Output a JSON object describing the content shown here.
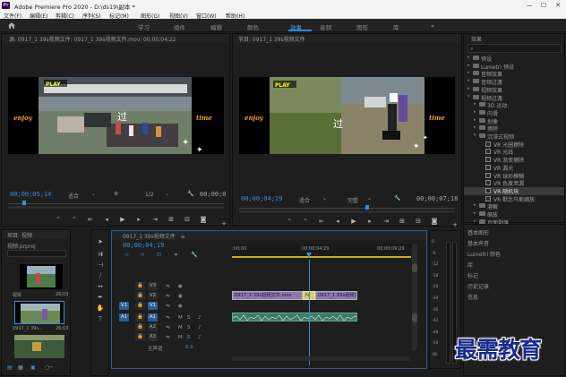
{
  "window": {
    "title": "Adobe Premiere Pro 2020 - D:\\ds19\\副本 *",
    "minimize": "—",
    "maximize": "☐",
    "close": "✕"
  },
  "menubar": [
    "文件(F)",
    "编辑(E)",
    "剪辑(C)",
    "序列(S)",
    "标记(M)",
    "图形(G)",
    "视图(V)",
    "窗口(W)",
    "帮助(H)"
  ],
  "workspace_tabs": [
    "学习",
    "组件",
    "编辑",
    "颜色",
    "效果",
    "音频",
    "图形",
    "库"
  ],
  "workspace_active": "效果",
  "source_monitor": {
    "header": "源: 0917_1 39s视频文件: 0917_1 39s视频文件.mov: 00;00;04;22",
    "timecode_in": "00;00;05;14",
    "fit": "适合",
    "ratio": "1/2",
    "timecode_out": "00;00;0",
    "overlay_text": "过",
    "play_label": "PLAY",
    "left_caption": "enjoy",
    "right_caption": "time"
  },
  "program_monitor": {
    "header": "节目: 0917_1 39s视频文件",
    "timecode_in": "00;00;04;19",
    "fit": "适合",
    "quality": "完整",
    "timecode_out": "00;00;07;18",
    "overlay_text": "过",
    "play_label": "PLAY",
    "left_caption": "enjoy",
    "right_caption": "time"
  },
  "effects_panel": {
    "title": "效果",
    "items": [
      {
        "label": "预设",
        "level": 0,
        "type": "folder",
        "open": false
      },
      {
        "label": "Lumetri 预设",
        "level": 0,
        "type": "folder",
        "open": false
      },
      {
        "label": "音频效果",
        "level": 0,
        "type": "folder",
        "open": false
      },
      {
        "label": "音频过渡",
        "level": 0,
        "type": "folder",
        "open": false
      },
      {
        "label": "视频效果",
        "level": 0,
        "type": "folder",
        "open": false
      },
      {
        "label": "视频过渡",
        "level": 0,
        "type": "folder",
        "open": true
      },
      {
        "label": "3D 运动",
        "level": 1,
        "type": "folder",
        "open": false
      },
      {
        "label": "内滑",
        "level": 1,
        "type": "folder",
        "open": false
      },
      {
        "label": "划像",
        "level": 1,
        "type": "folder",
        "open": false
      },
      {
        "label": "擦除",
        "level": 1,
        "type": "folder",
        "open": false
      },
      {
        "label": "沉浸式视频",
        "level": 1,
        "type": "folder",
        "open": true
      },
      {
        "label": "VR 光圈擦除",
        "level": 2,
        "type": "effect"
      },
      {
        "label": "VR 光线",
        "level": 2,
        "type": "effect"
      },
      {
        "label": "VR 渐变擦除",
        "level": 2,
        "type": "effect"
      },
      {
        "label": "VR 漏光",
        "level": 2,
        "type": "effect"
      },
      {
        "label": "VR 球形模糊",
        "level": 2,
        "type": "effect"
      },
      {
        "label": "VR 色度泄漏",
        "level": 2,
        "type": "effect"
      },
      {
        "label": "VR 随机块",
        "level": 2,
        "type": "effect",
        "selected": true
      },
      {
        "label": "VR 默比乌斯缩放",
        "level": 2,
        "type": "effect"
      },
      {
        "label": "溶解",
        "level": 1,
        "type": "folder",
        "open": false
      },
      {
        "label": "缩放",
        "level": 1,
        "type": "folder",
        "open": false
      },
      {
        "label": "页面剥落",
        "level": 1,
        "type": "folder",
        "open": false
      }
    ]
  },
  "side_panels": [
    "基本图形",
    "基本声音",
    "Lumetri 颜色",
    "库",
    "标记",
    "历史记录",
    "信息"
  ],
  "project_panel": {
    "header": "项目: 视频",
    "file": "视频.prproj",
    "items": [
      {
        "name": "视频",
        "duration": "26;03"
      },
      {
        "name": "0917_1 39s...",
        "duration": "26;03"
      },
      {
        "name": "",
        "duration": ""
      }
    ]
  },
  "timeline": {
    "header": "0917_1 39s视频文件",
    "timecode": "00;00;04;19",
    "ruler_labels": [
      ":00;00",
      "00;00;04;29",
      "00;00;09;29"
    ],
    "tracks": {
      "video": [
        {
          "name": "V3"
        },
        {
          "name": "V2"
        },
        {
          "name": "V1",
          "targeted": true,
          "source": "V1"
        }
      ],
      "audio": [
        {
          "name": "A1",
          "targeted": true,
          "source": "A1",
          "m": "M",
          "s": "S"
        },
        {
          "name": "A2",
          "m": "M",
          "s": "S"
        },
        {
          "name": "A3",
          "m": "M",
          "s": "S"
        }
      ]
    },
    "master": {
      "label": "主声道",
      "value": "0.0"
    },
    "clip_v2_a": "0917_1 39s视频文件.mov",
    "clip_v2_mid": "fx",
    "clip_v2_b": "0917_1 39s视频文件.mo",
    "clip_v1": "",
    "audio_meter_labels": [
      "0",
      "-6",
      "-12",
      "-18",
      "-24",
      "-30",
      "-36",
      "-42",
      "-48",
      "-54",
      "dB"
    ]
  },
  "watermark": "最需教育",
  "colors": {
    "accent": "#2d8ceb",
    "timecode": "#3b8edc",
    "playhead": "#3b8edc",
    "clip_video": "#8a7aaa",
    "clip_audio": "#3c7a66"
  }
}
